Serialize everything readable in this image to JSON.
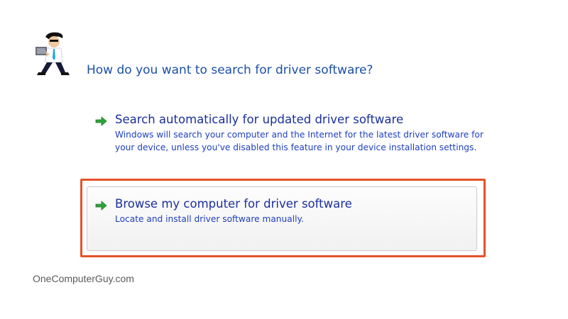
{
  "dialog": {
    "heading": "How do you want to search for driver software?"
  },
  "options": [
    {
      "title": "Search automatically for updated driver software",
      "description": "Windows will search your computer and the Internet for the latest driver software for your device, unless you've disabled this feature in your device installation settings.",
      "icon": "green-arrow-icon"
    },
    {
      "title": "Browse my computer for driver software",
      "description": "Locate and install driver software manually.",
      "icon": "green-arrow-icon",
      "highlighted": true
    }
  ],
  "watermark": "OneComputerGuy.com",
  "colors": {
    "link_blue": "#1b2f9c",
    "heading_blue": "#1c4fa8",
    "arrow_green": "#2ea33a",
    "highlight": "#e5522a"
  }
}
